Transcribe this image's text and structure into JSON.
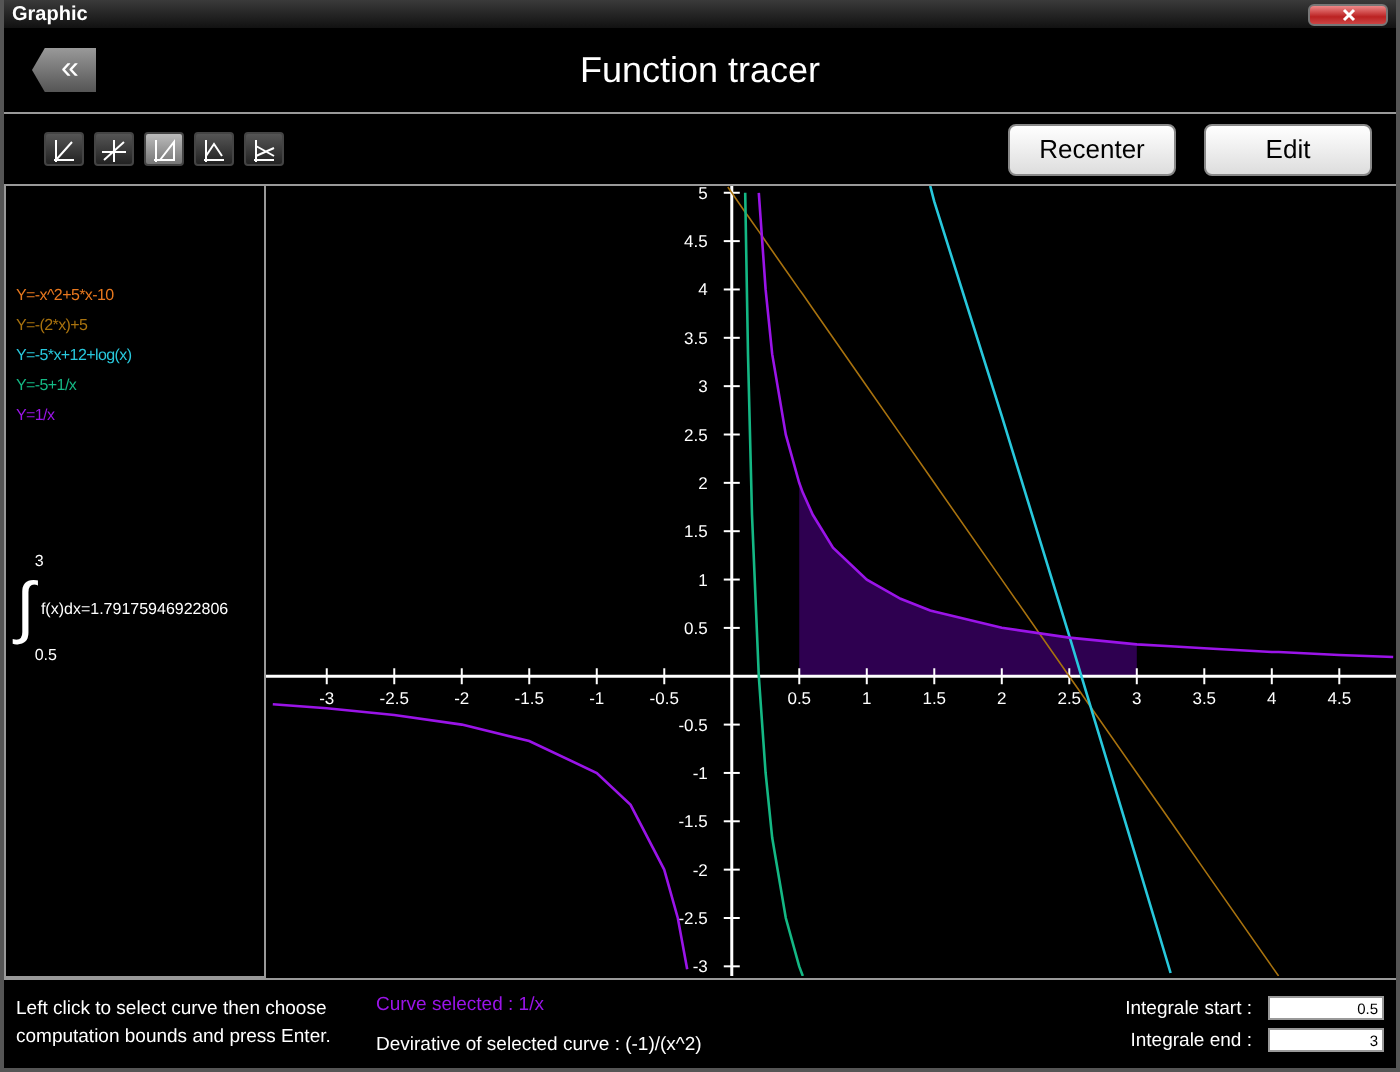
{
  "window": {
    "title": "Graphic"
  },
  "header": {
    "back_label": "«",
    "title": "Function tracer"
  },
  "toolbar": {
    "tools": [
      {
        "selected": false
      },
      {
        "selected": false
      },
      {
        "selected": true
      },
      {
        "selected": false
      },
      {
        "selected": false
      }
    ],
    "buttons": [
      "Recenter",
      "Edit"
    ]
  },
  "functions": [
    {
      "label": "Y=-x^2+5*x-10",
      "color": "#e8781e",
      "selected": false
    },
    {
      "label": "Y=-(2*x)+5",
      "color": "#a8720e",
      "selected": false
    },
    {
      "label": "Y=-5*x+12+log(x)",
      "color": "#28c8dc",
      "selected": false
    },
    {
      "label": "Y=-5+1/x",
      "color": "#14b884",
      "selected": false
    },
    {
      "label": "Y=1/x",
      "color": "#9a14e8",
      "selected": true
    }
  ],
  "integral": {
    "symbol": "∫",
    "upper": "3",
    "lower": "0.5",
    "expression": "f(x)dx=1.79175946922806"
  },
  "graph": {
    "chart_data": {
      "type": "line",
      "xlim": [
        -3.45,
        4.92
      ],
      "ylim": [
        -3.1,
        5.07
      ],
      "xticks": [
        -3,
        -2.5,
        -2,
        -1.5,
        -1,
        -0.5,
        0.5,
        1,
        1.5,
        2,
        2.5,
        3,
        3.5,
        4,
        4.5
      ],
      "yticks": [
        -3,
        -2.5,
        -2,
        -1.5,
        -1,
        -0.5,
        0.5,
        1,
        1.5,
        2,
        2.5,
        3,
        3.5,
        4,
        4.5,
        5
      ],
      "x": [
        -3.4,
        -3,
        -2.5,
        -2,
        -1.5,
        -1,
        -0.75,
        -0.5,
        -0.4,
        -0.33,
        -0.03,
        0,
        0.1,
        0.12,
        0.15,
        0.2,
        0.25,
        0.3,
        0.4,
        0.5,
        0.526,
        0.6,
        0.75,
        1,
        1.25,
        1.47,
        1.5,
        2,
        2.5,
        3,
        3.25,
        3.5,
        4,
        4.05,
        4.5,
        4.9
      ],
      "series": [
        {
          "color": "#a8720e",
          "values": [
            null,
            null,
            null,
            null,
            null,
            null,
            null,
            null,
            null,
            null,
            5.06,
            5,
            4.8,
            4.76,
            4.7,
            4.6,
            4.5,
            4.4,
            4.2,
            4,
            3.95,
            3.8,
            3.5,
            3,
            2.5,
            2.06,
            2,
            1,
            0,
            -1,
            -1.5,
            -2,
            -3,
            -3.1,
            null,
            null
          ]
        },
        {
          "color": "#28c8dc",
          "values": [
            null,
            null,
            null,
            null,
            null,
            null,
            null,
            null,
            null,
            null,
            null,
            null,
            null,
            null,
            null,
            null,
            null,
            null,
            null,
            null,
            null,
            null,
            null,
            null,
            null,
            5.07,
            4.91,
            2.69,
            0.42,
            -1.9,
            -3.07,
            null,
            null,
            null,
            null,
            null
          ]
        },
        {
          "color": "#14b884",
          "values": [
            null,
            null,
            null,
            null,
            null,
            null,
            null,
            null,
            null,
            null,
            null,
            null,
            5,
            3.33,
            1.67,
            0,
            -1,
            -1.67,
            -2.5,
            -3,
            -3.1,
            null,
            null,
            null,
            null,
            null,
            null,
            null,
            null,
            null,
            null,
            null,
            null,
            null,
            null,
            null
          ]
        },
        {
          "color": "#9a14e8",
          "values": [
            -0.29,
            -0.33,
            -0.4,
            -0.5,
            -0.67,
            -1,
            -1.33,
            -2,
            -2.5,
            -3.03,
            null,
            null,
            null,
            null,
            null,
            5,
            4,
            3.33,
            2.5,
            2,
            1.9,
            1.67,
            1.33,
            1,
            0.8,
            0.68,
            0.67,
            0.5,
            0.4,
            0.33,
            0.31,
            0.29,
            0.25,
            0.25,
            0.22,
            0.2
          ]
        }
      ]
    }
  },
  "footer": {
    "instructions": "Left click to select curve then choose computation bounds and press Enter.",
    "curve_selected": "Curve selected : 1/x",
    "derivative": "Devirative of selected curve : (-1)/(x^2)",
    "fields": [
      {
        "label": "Integrale start :",
        "value": "0.5"
      },
      {
        "label": "Integrale end :",
        "value": "3"
      }
    ]
  }
}
